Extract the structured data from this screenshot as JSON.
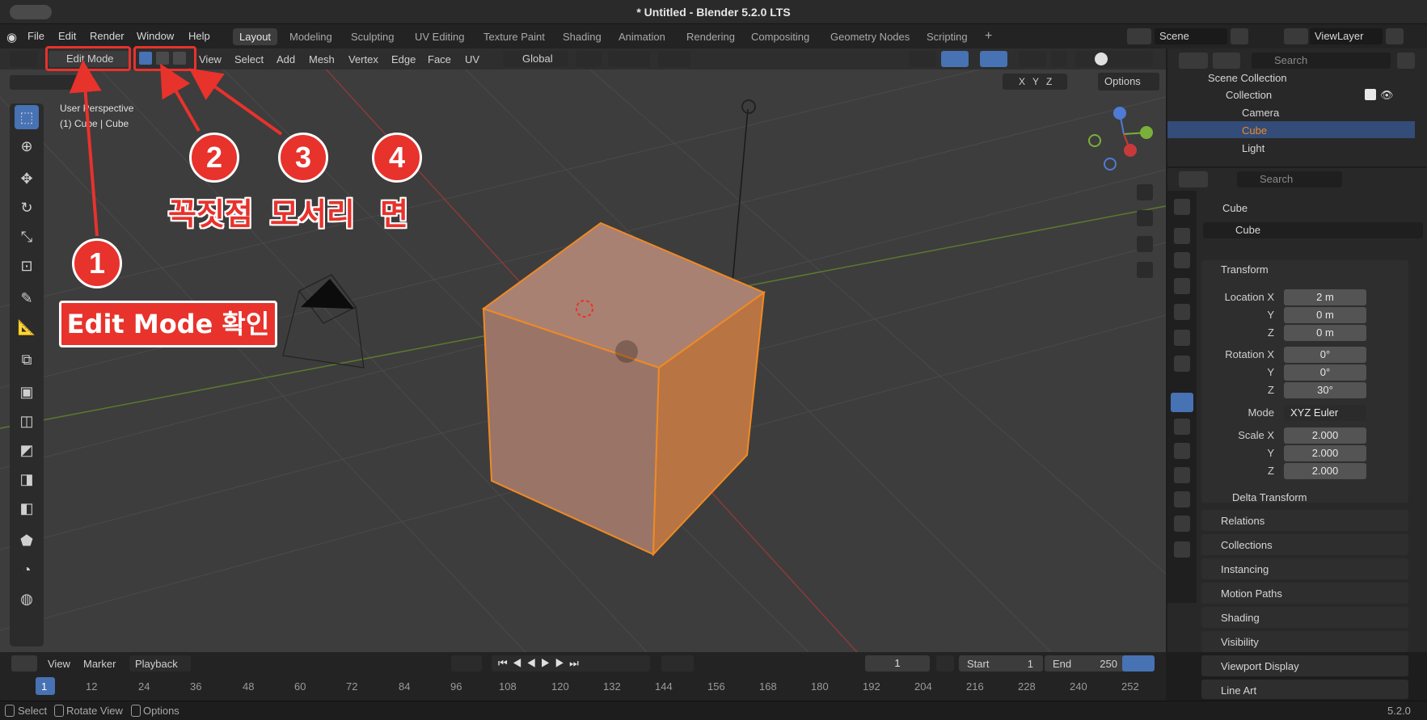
{
  "window": {
    "title": "* Untitled - Blender 5.2.0 LTS"
  },
  "menu": {
    "items": [
      "File",
      "Edit",
      "Render",
      "Window",
      "Help"
    ]
  },
  "workspaces": {
    "tabs": [
      "Layout",
      "Modeling",
      "Sculpting",
      "UV Editing",
      "Texture Paint",
      "Shading",
      "Animation",
      "Rendering",
      "Compositing",
      "Geometry Nodes",
      "Scripting"
    ],
    "active": "Layout",
    "add": "+"
  },
  "scene": {
    "name": "Scene",
    "view_layer": "ViewLayer"
  },
  "viewport_header": {
    "mode": "Edit Mode",
    "menus": [
      "View",
      "Select",
      "Add",
      "Mesh",
      "Vertex",
      "Edge",
      "Face",
      "UV"
    ],
    "orientation": "Global",
    "options": "Options",
    "axes": [
      "X",
      "Y",
      "Z"
    ]
  },
  "viewport": {
    "perspective": "User Perspective",
    "object_info": "(1) Cube | Cube"
  },
  "annotations": {
    "badges": [
      "1",
      "2",
      "3",
      "4"
    ],
    "vertex": "꼭짓점",
    "edge": "모서리",
    "face": "면",
    "edit_mode_note": "Edit Mode 확인"
  },
  "outliner": {
    "search": "Search",
    "scene_collection": "Scene Collection",
    "collection": "Collection",
    "items": [
      "Camera",
      "Cube",
      "Light"
    ]
  },
  "properties": {
    "search": "Search",
    "object_name": "Cube",
    "data_name": "Cube",
    "transform": {
      "title": "Transform",
      "location_label": "Location X",
      "location": [
        "2 m",
        "0 m",
        "0 m"
      ],
      "rotation_label": "Rotation X",
      "rotation": [
        "0°",
        "0°",
        "30°"
      ],
      "mode_label": "Mode",
      "mode": "XYZ Euler",
      "scale_label": "Scale X",
      "scale": [
        "2.000",
        "2.000",
        "2.000"
      ],
      "y": "Y",
      "z": "Z"
    },
    "delta": "Delta Transform",
    "sections": [
      "Relations",
      "Collections",
      "Instancing",
      "Motion Paths",
      "Shading",
      "Visibility",
      "Viewport Display",
      "Line Art"
    ]
  },
  "timeline": {
    "menus": [
      "View",
      "Marker",
      "Playback"
    ],
    "current_frame": "1",
    "start_label": "Start",
    "start": "1",
    "end_label": "End",
    "end": "250",
    "ticks": [
      "1",
      "12",
      "24",
      "36",
      "48",
      "60",
      "72",
      "84",
      "96",
      "108",
      "120",
      "132",
      "144",
      "156",
      "168",
      "180",
      "192",
      "204",
      "216",
      "228",
      "240",
      "252"
    ]
  },
  "statusbar": {
    "select": "Select",
    "rotate": "Rotate View",
    "options": "Options",
    "version": "5.2.0"
  },
  "colors": {
    "accent": "#e8322c",
    "selection": "#f08a24",
    "active_blue": "#4772b3"
  }
}
